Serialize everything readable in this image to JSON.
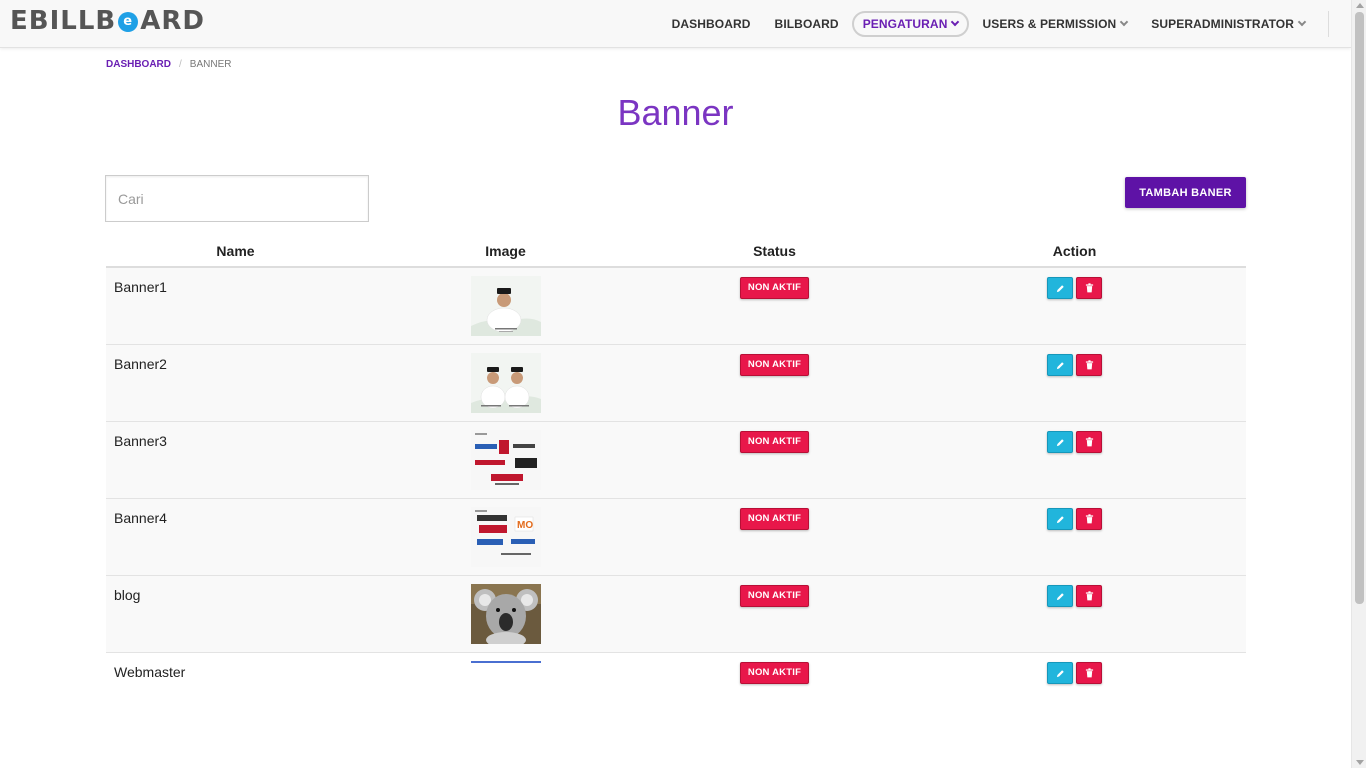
{
  "app": {
    "logo_text_left": "EBILLB",
    "logo_mark": "e",
    "logo_text_right": "ARD"
  },
  "nav": {
    "items": [
      {
        "label": "DASHBOARD",
        "active": false,
        "dropdown": false
      },
      {
        "label": "BILBOARD",
        "active": false,
        "dropdown": false
      },
      {
        "label": "PENGATURAN",
        "active": true,
        "dropdown": true
      },
      {
        "label": "USERS & PERMISSION",
        "active": false,
        "dropdown": true
      },
      {
        "label": "SUPERADMINISTRATOR",
        "active": false,
        "dropdown": true
      }
    ]
  },
  "breadcrumb": {
    "home": "DASHBOARD",
    "separator": "/",
    "current": "BANNER"
  },
  "page": {
    "title": "Banner"
  },
  "search": {
    "placeholder": "Cari",
    "value": ""
  },
  "toolbar": {
    "add_label": "TAMBAH BANER"
  },
  "table": {
    "headers": {
      "name": "Name",
      "image": "Image",
      "status": "Status",
      "action": "Action"
    },
    "rows": [
      {
        "name": "Banner1",
        "status": "NON AKTIF",
        "image_icon": "single-portrait-thumbnail"
      },
      {
        "name": "Banner2",
        "status": "NON AKTIF",
        "image_icon": "double-portrait-thumbnail"
      },
      {
        "name": "Banner3",
        "status": "NON AKTIF",
        "image_icon": "media-logos-thumbnail"
      },
      {
        "name": "Banner4",
        "status": "NON AKTIF",
        "image_icon": "media-logos-thumbnail"
      },
      {
        "name": "blog",
        "status": "NON AKTIF",
        "image_icon": "koala-photo-thumbnail"
      },
      {
        "name": "Webmaster",
        "status": "NON AKTIF",
        "image_icon": "partially-loaded-thumbnail"
      }
    ]
  },
  "icons": {
    "edit": "pencil-icon",
    "delete": "trash-icon",
    "dropdown": "chevron-down-icon"
  },
  "colors": {
    "brand_purple": "#5e12a6",
    "title_purple": "#7b35c2",
    "status_red": "#e8174a",
    "edit_cyan": "#21b5dc",
    "logo_blue": "#1fa0e6"
  }
}
